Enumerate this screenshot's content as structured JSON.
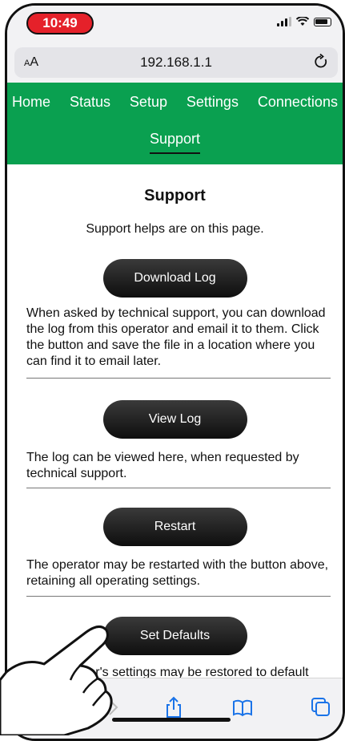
{
  "status_bar": {
    "time": "10:49"
  },
  "browser": {
    "text_size_label": "AA",
    "url": "192.168.1.1"
  },
  "nav": {
    "items": [
      "Home",
      "Status",
      "Setup",
      "Settings",
      "Connections"
    ],
    "active": "Support"
  },
  "page": {
    "title": "Support",
    "intro": "Support helps are on this page.",
    "sections": [
      {
        "button": "Download Log",
        "description": "When asked by technical support, you can download the log from this operator and email it to them. Click the button and save the file in a location where you can find it to email later."
      },
      {
        "button": "View Log",
        "description": "The log can be viewed here, when requested by technical support."
      },
      {
        "button": "Restart",
        "description": "The operator may be restarted with the button above, retaining all operating settings."
      },
      {
        "button": "Set Defaults",
        "description": "The operator's settings may be restored to default"
      }
    ]
  },
  "colors": {
    "nav_bg": "#0aa050",
    "time_pill": "#e5212a",
    "button_bg": "#1a1a1a"
  },
  "icons": [
    "reload-icon",
    "share-icon",
    "bookmarks-icon",
    "tabs-icon",
    "forward-icon"
  ]
}
